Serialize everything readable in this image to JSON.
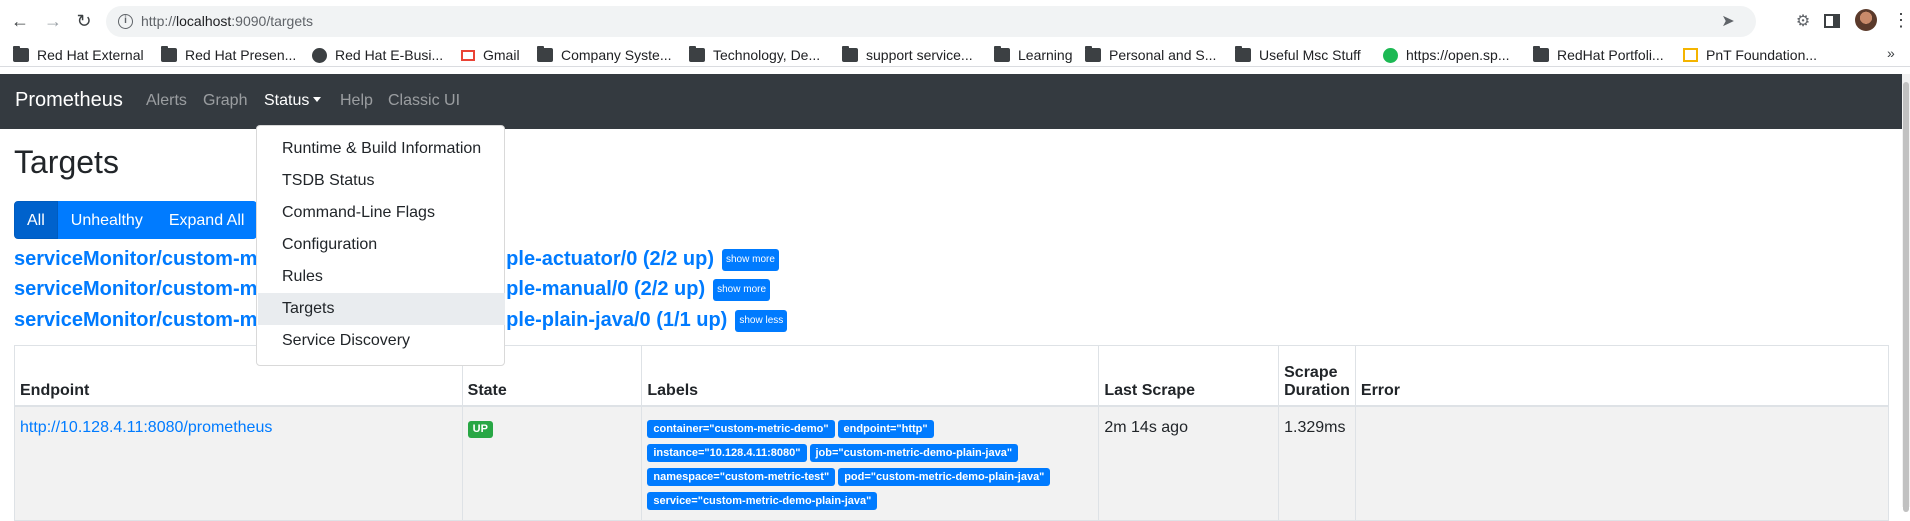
{
  "browser": {
    "url_prefix": "http://",
    "url_host": "localhost",
    "url_rest": ":9090/targets",
    "bookmarks": [
      {
        "label": "Red Hat External",
        "icon": "folder-icon"
      },
      {
        "label": "Red Hat Presen...",
        "icon": "folder-icon"
      },
      {
        "label": "Red Hat E-Busi...",
        "icon": "globe-icon"
      },
      {
        "label": "Gmail",
        "icon": "gmail-icon"
      },
      {
        "label": "Company Syste...",
        "icon": "folder-icon"
      },
      {
        "label": "Technology, De...",
        "icon": "folder-icon"
      },
      {
        "label": "support service...",
        "icon": "folder-icon"
      },
      {
        "label": "Learning",
        "icon": "folder-icon"
      },
      {
        "label": "Personal and S...",
        "icon": "folder-icon"
      },
      {
        "label": "Useful Msc Stuff",
        "icon": "folder-icon"
      },
      {
        "label": "https://open.sp...",
        "icon": "spotify-icon"
      },
      {
        "label": "RedHat Portfoli...",
        "icon": "folder-icon"
      },
      {
        "label": "PnT Foundation...",
        "icon": "pnt-icon"
      }
    ],
    "more": "»"
  },
  "navbar": {
    "brand": "Prometheus",
    "links": {
      "alerts": "Alerts",
      "graph": "Graph",
      "status": "Status",
      "help": "Help",
      "classic": "Classic UI"
    }
  },
  "dropdown": {
    "items": [
      "Runtime & Build Information",
      "TSDB Status",
      "Command-Line Flags",
      "Configuration",
      "Rules",
      "Targets",
      "Service Discovery"
    ],
    "hovered": "Targets"
  },
  "page": {
    "title": "Targets",
    "filters": {
      "all": "All",
      "unhealthy": "Unhealthy",
      "expand": "Expand All"
    },
    "pools": [
      {
        "prefix": "serviceMonitor/custom-m",
        "suffix": "mple-actuator/0 (2/2 up)",
        "toggle": "show more"
      },
      {
        "prefix": "serviceMonitor/custom-m",
        "suffix": "mple-manual/0 (2/2 up)",
        "toggle": "show more"
      },
      {
        "prefix": "serviceMonitor/custom-m",
        "suffix": "mple-plain-java/0 (1/1 up)",
        "toggle": "show less"
      }
    ]
  },
  "table": {
    "headers": {
      "endpoint": "Endpoint",
      "state": "State",
      "labels": "Labels",
      "last_scrape": "Last Scrape",
      "scrape_duration": "Scrape Duration",
      "error": "Error"
    },
    "rows": [
      {
        "endpoint": "http://10.128.4.11:8080/prometheus",
        "state": "UP",
        "labels": [
          "container=\"custom-metric-demo\"",
          "endpoint=\"http\"",
          "instance=\"10.128.4.11:8080\"",
          "job=\"custom-metric-demo-plain-java\"",
          "namespace=\"custom-metric-test\"",
          "pod=\"custom-metric-demo-plain-java\"",
          "service=\"custom-metric-demo-plain-java\""
        ],
        "last_scrape": "2m 14s ago",
        "scrape_duration": "1.329ms",
        "error": ""
      }
    ]
  },
  "colors": {
    "navbar_bg": "#343a40",
    "primary": "#007bff",
    "success": "#28a745",
    "row_bg": "#f2f2f2"
  }
}
